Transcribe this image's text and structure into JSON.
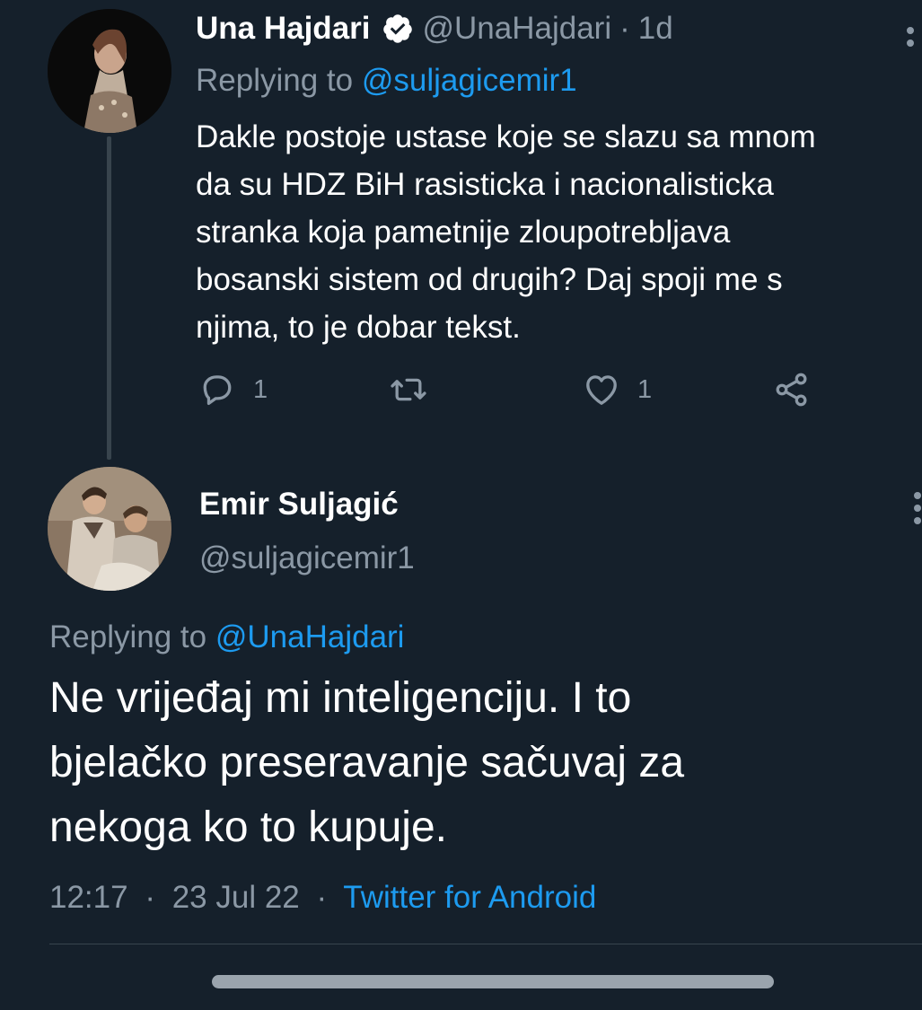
{
  "tweet1": {
    "name": "Una Hajdari",
    "handle": "@UnaHajdari",
    "separator": "·",
    "time": "1d",
    "replying_prefix": "Replying to",
    "replying_handle": "@suljagicemir1",
    "lines": [
      "Dakle postoje ustase koje se slazu sa mnom",
      "da su HDZ BiH rasisticka i nacionalisticka",
      "stranka koja pametnije zloupotrebljava",
      "bosanski sistem od drugih? Daj spoji me s",
      "njima, to je dobar tekst."
    ],
    "actions": {
      "reply_count": "1",
      "like_count": "1",
      "reply_icon": "speech-bubble-icon",
      "retweet_icon": "retweet-arrows-icon",
      "like_icon": "heart-icon",
      "share_icon": "share-nodes-icon"
    }
  },
  "tweet2": {
    "name": "Emir Suljagić",
    "handle": "@suljagicemir1",
    "replying_prefix": "Replying to",
    "replying_handle": "@UnaHajdari",
    "lines": [
      "Ne vrijeđaj mi inteligenciju. I to",
      "bjelačko preseravanje sačuvaj za",
      "nekoga ko to kupuje."
    ],
    "time": "12:17",
    "date": "23 Jul 22",
    "separator": "·",
    "source": "Twitter for Android"
  },
  "colors": {
    "background": "#15202b",
    "text": "#ffffff",
    "muted": "#8b98a5",
    "link": "#1d9bf0",
    "divider": "#38444d"
  }
}
